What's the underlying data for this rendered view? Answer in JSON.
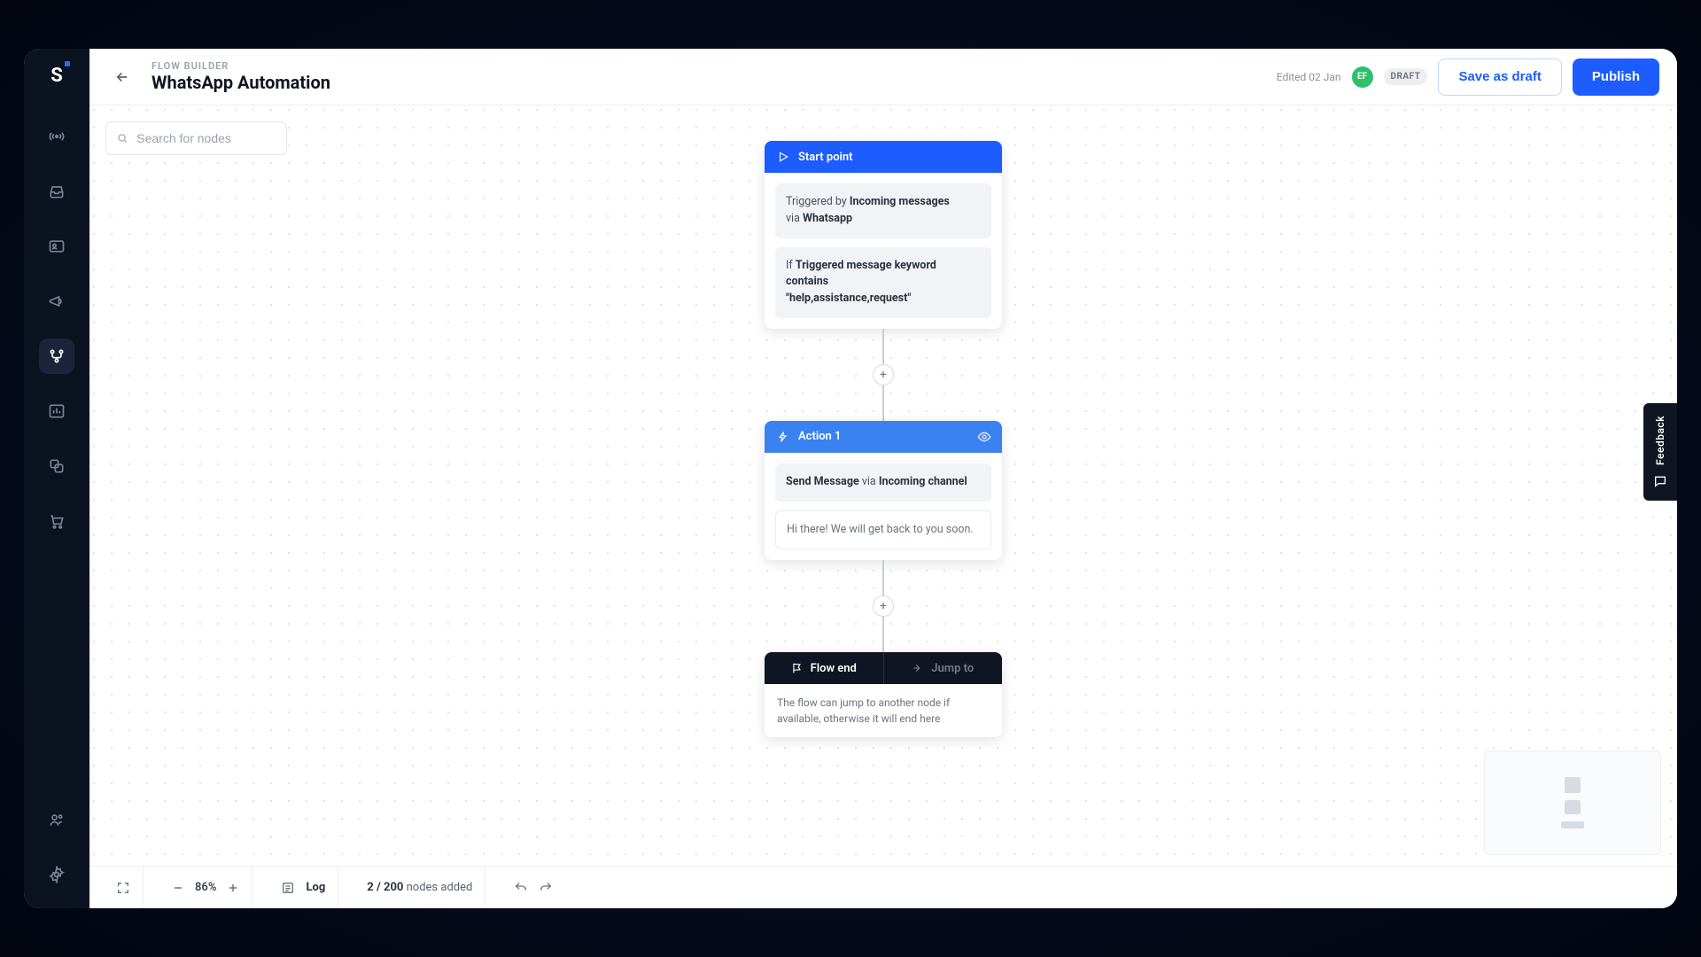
{
  "header": {
    "crumb": "FLOW BUILDER",
    "title": "WhatsApp Automation",
    "edited": "Edited 02 Jan",
    "avatar": "EF",
    "status": "DRAFT",
    "save_btn": "Save as draft",
    "publish_btn": "Publish"
  },
  "search": {
    "placeholder": "Search for nodes"
  },
  "nodes": {
    "start": {
      "title": "Start point",
      "trigger_pre": "Triggered by ",
      "trigger_bold": "Incoming messages",
      "trigger_via": "via ",
      "trigger_channel": "Whatsapp",
      "cond_pre": "If ",
      "cond_bold1": "Triggered message keyword contains",
      "cond_bold2": "\"help,assistance,request\""
    },
    "action": {
      "title": "Action 1",
      "send_bold": "Send Message",
      "send_via": " via ",
      "send_channel": "Incoming channel",
      "message": "Hi there! We will get back to you soon."
    },
    "end": {
      "tab_end": "Flow end",
      "tab_jump": "Jump to",
      "body": "The flow can jump to another node if available, otherwise it will end here"
    }
  },
  "toolbar": {
    "zoom": "86%",
    "log": "Log",
    "nodes_bold": "2 / 200",
    "nodes_rest": " nodes added"
  },
  "feedback": {
    "label": "Feedback"
  }
}
